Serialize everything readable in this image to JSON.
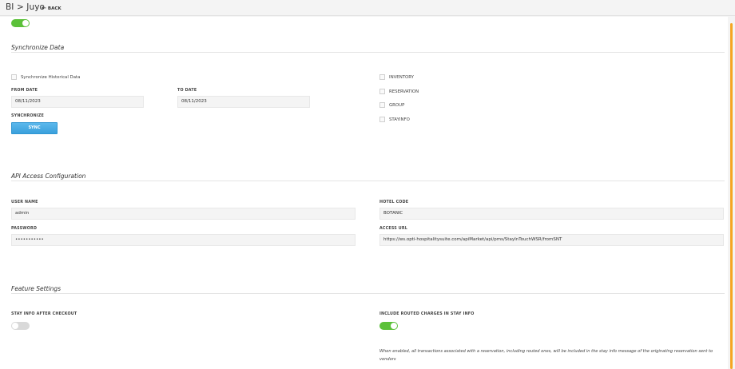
{
  "header": {
    "breadcrumb": "BI > Juyo",
    "back_label": "BACK"
  },
  "top_toggle": {
    "on": true
  },
  "sync_section": {
    "title": "Synchronize Data",
    "historical_label": "Synchronize Historical Data",
    "from_date_label": "FROM DATE",
    "from_date_value": "08/11/2023",
    "to_date_label": "TO DATE",
    "to_date_value": "08/11/2023",
    "synchronize_label": "SYNCHRONIZE",
    "sync_button": "SYNC",
    "options": [
      "INVENTORY",
      "RESERVATION",
      "GROUP",
      "STAYINFO"
    ]
  },
  "api_section": {
    "title": "API Access Configuration",
    "username_label": "USER NAME",
    "username_value": "admin",
    "password_label": "PASSWORD",
    "password_value": "•••••••••••",
    "hotel_code_label": "HOTEL CODE",
    "hotel_code_value": "BOTANIC",
    "access_url_label": "ACCESS URL",
    "access_url_value": "https://ws.opti-hospitalitysuite.com/apiMarket/api/pms/StayInTouchWSR/fromSNT"
  },
  "feature_section": {
    "title": "Feature Settings",
    "stay_info_label": "STAY INFO AFTER CHECKOUT",
    "stay_info_on": false,
    "routed_label": "INCLUDE ROUTED CHARGES IN STAY INFO",
    "routed_on": true,
    "routed_note": "When enabled, all transactions associated with a reservation, including routed ones, will be included in the stay info message of the originating reservation sent to vendors"
  },
  "colors": {
    "toggle_on": "#5cc13a",
    "toggle_off": "#d9d9d9",
    "sync_button": "#3aa0dc",
    "scrollbar_thumb": "#f5a623"
  }
}
